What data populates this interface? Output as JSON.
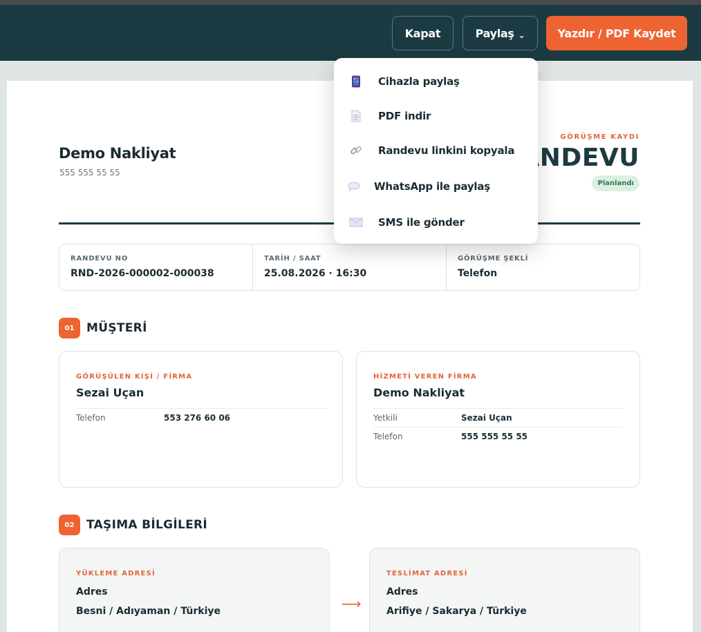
{
  "toolbar": {
    "close_label": "Kapat",
    "share_label": "Paylaş",
    "print_label": "Yazdır / PDF Kaydet"
  },
  "share_menu": {
    "items": [
      {
        "label": "Cihazla paylaş",
        "icon": "phone-icon"
      },
      {
        "label": "PDF indir",
        "icon": "document-icon"
      },
      {
        "label": "Randevu linkini kopyala",
        "icon": "link-icon"
      },
      {
        "label": "WhatsApp ile paylaş",
        "icon": "chat-bubble-icon"
      },
      {
        "label": "SMS ile gönder",
        "icon": "envelope-icon"
      }
    ]
  },
  "header": {
    "company_name": "Demo Nakliyat",
    "company_phone": "555 555 55 55",
    "kicker": "GÖRÜŞME KAYDI",
    "title": "RANDEVU",
    "status": "Planlandı"
  },
  "info": [
    {
      "label": "RANDEVU NO",
      "value": "RND-2026-000002-000038"
    },
    {
      "label": "TARİH / SAAT",
      "value": "25.08.2026 · 16:30"
    },
    {
      "label": "GÖRÜŞME ŞEKLİ",
      "value": "Telefon"
    }
  ],
  "sections": {
    "customer": {
      "number": "01",
      "title": "MÜŞTERİ"
    },
    "transport": {
      "number": "02",
      "title": "TAŞIMA BİLGİLERİ"
    }
  },
  "customer_card": {
    "kicker": "GÖRÜŞÜLEN KİŞİ / FİRMA",
    "name": "Sezai Uçan",
    "rows": [
      {
        "key": "Telefon",
        "value": "553 276 60 06"
      }
    ]
  },
  "provider_card": {
    "kicker": "HİZMETİ VEREN FİRMA",
    "name": "Demo Nakliyat",
    "rows": [
      {
        "key": "Yetkili",
        "value": "Sezai Uçan"
      },
      {
        "key": "Telefon",
        "value": "555 555 55 55"
      }
    ]
  },
  "pickup": {
    "kicker": "YÜKLEME ADRESİ",
    "label": "Adres",
    "value": "Besni / Adıyaman / Türkiye"
  },
  "delivery": {
    "kicker": "TESLİMAT ADRESİ",
    "label": "Adres",
    "value": "Arifiye / Sakarya / Türkiye"
  },
  "colors": {
    "topbar": "#1c3a42",
    "accent": "#ee6332",
    "status_bg": "#dcefe3",
    "status_text": "#2e7a4d"
  }
}
